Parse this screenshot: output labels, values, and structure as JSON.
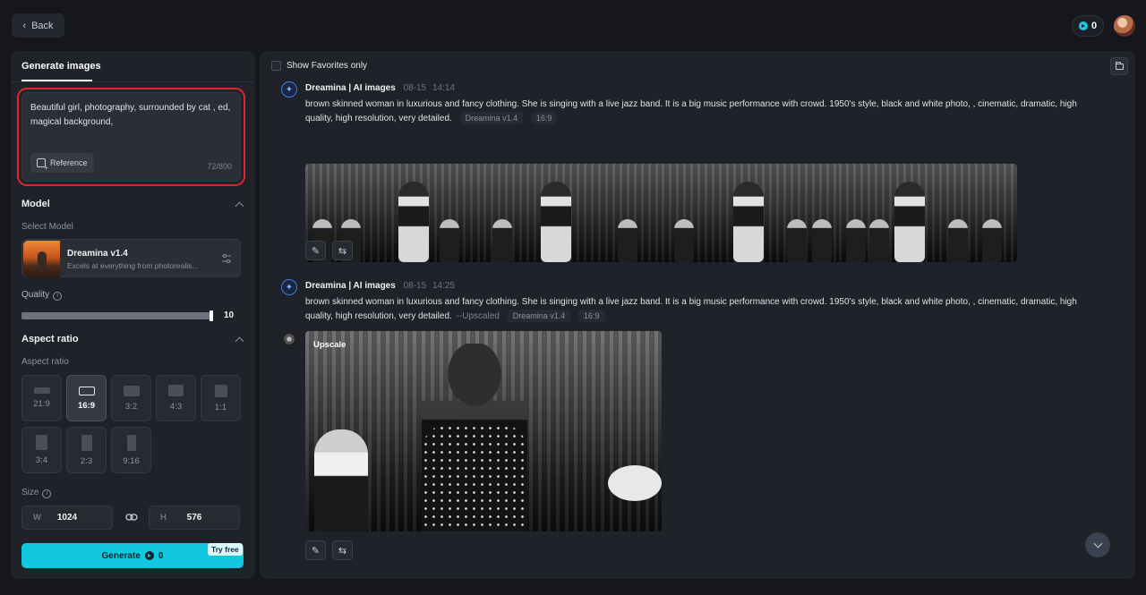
{
  "header": {
    "back_label": "Back",
    "credits": "0"
  },
  "left_panel": {
    "tab_label": "Generate images",
    "prompt": {
      "text": "Beautiful girl, photography, surrounded by cat , ed, magical background,",
      "reference_label": "Reference",
      "char_count": "72/800"
    },
    "model": {
      "section_title": "Model",
      "select_label": "Select Model",
      "name": "Dreamina v1.4",
      "description": "Excels at everything from photorealis..."
    },
    "quality": {
      "label": "Quality",
      "value": "10",
      "fraction": 1.0
    },
    "aspect_ratio": {
      "section_title": "Aspect ratio",
      "sub_label": "Aspect ratio",
      "selected": "16:9",
      "options": [
        "21:9",
        "16:9",
        "3:2",
        "4:3",
        "1:1",
        "3:4",
        "2:3",
        "9:16"
      ]
    },
    "size": {
      "label": "Size",
      "width_prefix": "W",
      "width_value": "1024",
      "height_prefix": "H",
      "height_value": "576"
    },
    "generate": {
      "label": "Generate",
      "cost": "0",
      "badge": "Try free"
    }
  },
  "right_panel": {
    "favorites_label": "Show Favorites only",
    "entries": [
      {
        "name": "Dreamina | AI images",
        "date": "08-15",
        "time": "14:14",
        "prompt": "brown skinned woman in luxurious and fancy clothing. She is singing with a live jazz band. It is a big music performance with crowd. 1950's style, black and white photo, , cinematic, dramatic, high quality, high resolution, very detailed.",
        "model_tag": "Dreamina v1.4",
        "ratio_tag": "16:9"
      },
      {
        "name": "Dreamina | AI images",
        "date": "08-15",
        "time": "14:25",
        "prompt": "brown skinned woman in luxurious and fancy clothing. She is singing with a live jazz band. It is a big music performance with crowd. 1950's style, black and white photo, , cinematic, dramatic, high quality, high resolution, very detailed.",
        "upscaled_tag": "--Upscaled",
        "model_tag": "Dreamina v1.4",
        "ratio_tag": "16:9",
        "upscale_label": "Upscale"
      }
    ]
  }
}
